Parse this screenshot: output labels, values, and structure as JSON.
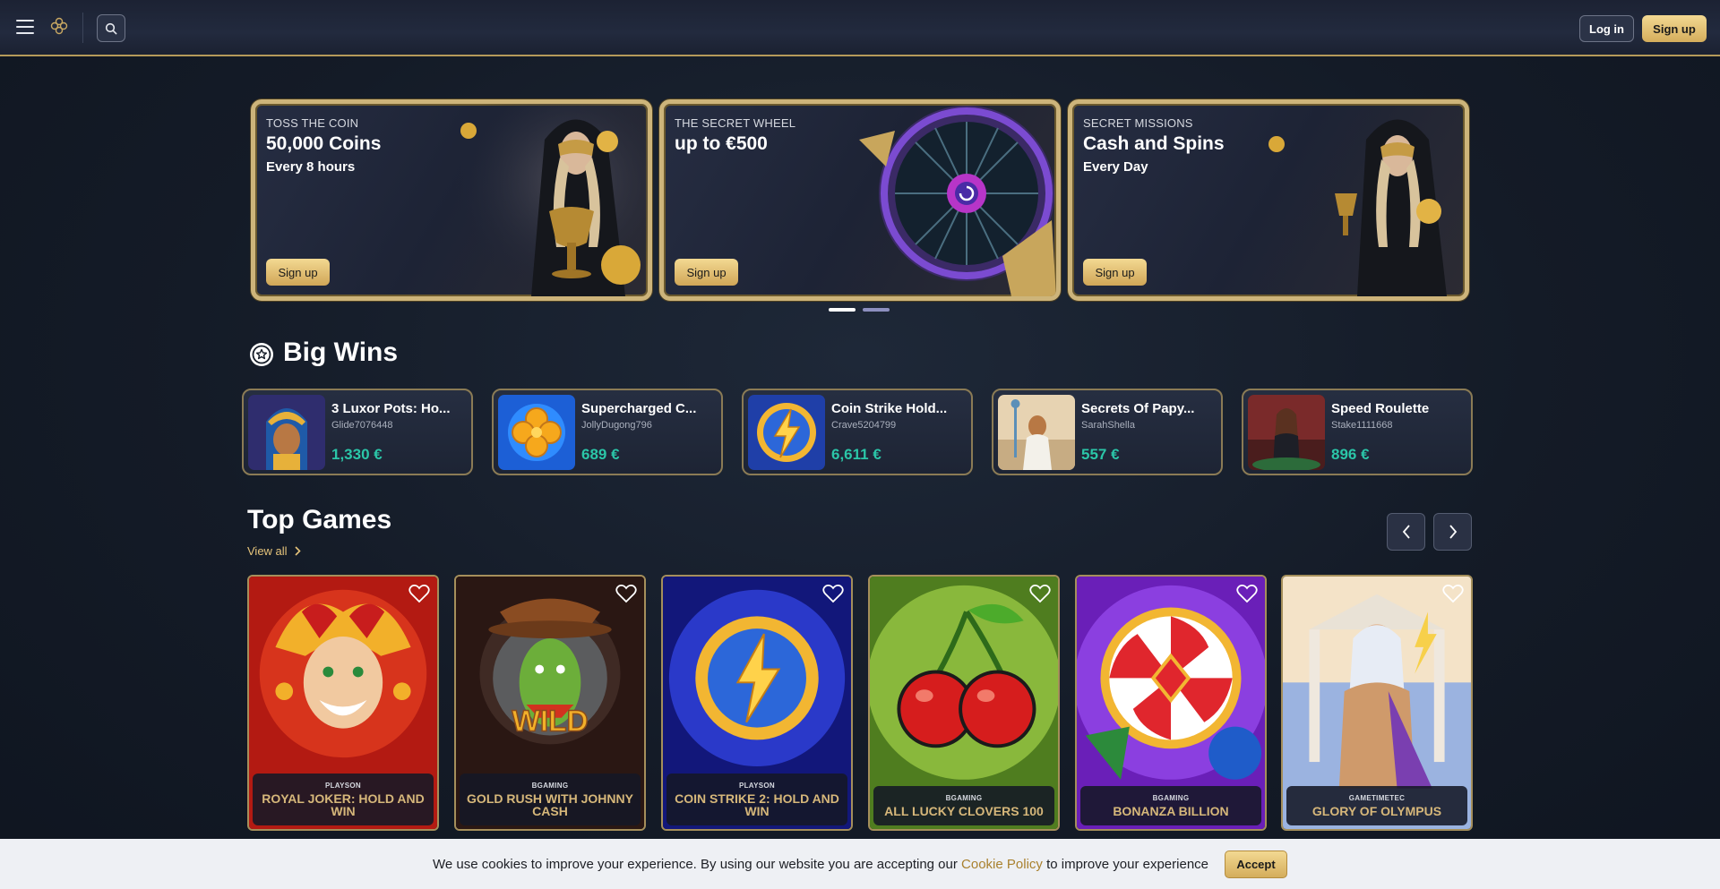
{
  "header": {
    "menu_icon": "hamburger-icon",
    "logo_icon": "brand-logo-icon",
    "search_icon": "search-icon",
    "login_label": "Log in",
    "signup_label": "Sign up"
  },
  "promos": [
    {
      "eyebrow": "TOSS THE COIN",
      "headline": "50,000 Coins",
      "sub": "Every 8 hours",
      "cta": "Sign up"
    },
    {
      "eyebrow": "THE SECRET WHEEL",
      "headline": "up to €500",
      "sub": "",
      "cta": "Sign up"
    },
    {
      "eyebrow": "SECRET MISSIONS",
      "headline": "Cash and Spins",
      "sub": "Every Day",
      "cta": "Sign up"
    }
  ],
  "carousel": {
    "slides": 2,
    "active": 1
  },
  "big_wins": {
    "title": "Big Wins",
    "icon": "star-badge-icon",
    "items": [
      {
        "game": "3 Luxor Pots: Ho...",
        "user": "Glide7076448",
        "amount": "1,330 €"
      },
      {
        "game": "Supercharged C...",
        "user": "JollyDugong796",
        "amount": "689 €"
      },
      {
        "game": "Coin Strike Hold...",
        "user": "Crave5204799",
        "amount": "6,611 €"
      },
      {
        "game": "Secrets Of Papy...",
        "user": "SarahShella",
        "amount": "557 €"
      },
      {
        "game": "Speed Roulette",
        "user": "Stake1111668",
        "amount": "896 €"
      }
    ]
  },
  "top_games": {
    "title": "Top Games",
    "view_all": "View all",
    "items": [
      {
        "provider": "PLAYSON",
        "title": "ROYAL JOKER: HOLD AND WIN"
      },
      {
        "provider": "BGAMING",
        "title": "GOLD RUSH WITH JOHNNY CASH"
      },
      {
        "provider": "PLAYSON",
        "title": "COIN STRIKE 2: HOLD AND WIN"
      },
      {
        "provider": "BGAMING",
        "title": "ALL LUCKY CLOVERS 100"
      },
      {
        "provider": "BGAMING",
        "title": "BONANZA BILLION"
      },
      {
        "provider": "GAMETIMETEC",
        "title": "GLORY OF OLYMPUS"
      }
    ]
  },
  "cookie": {
    "text_before": "We use cookies to improve your experience. By using our website you are accepting our",
    "link": "Cookie Policy",
    "text_after": "to improve your experience",
    "accept": "Accept"
  },
  "colors": {
    "accent_gold": "#d4ad5c",
    "win_amount": "#2bc6a8",
    "background": "#141b27"
  }
}
